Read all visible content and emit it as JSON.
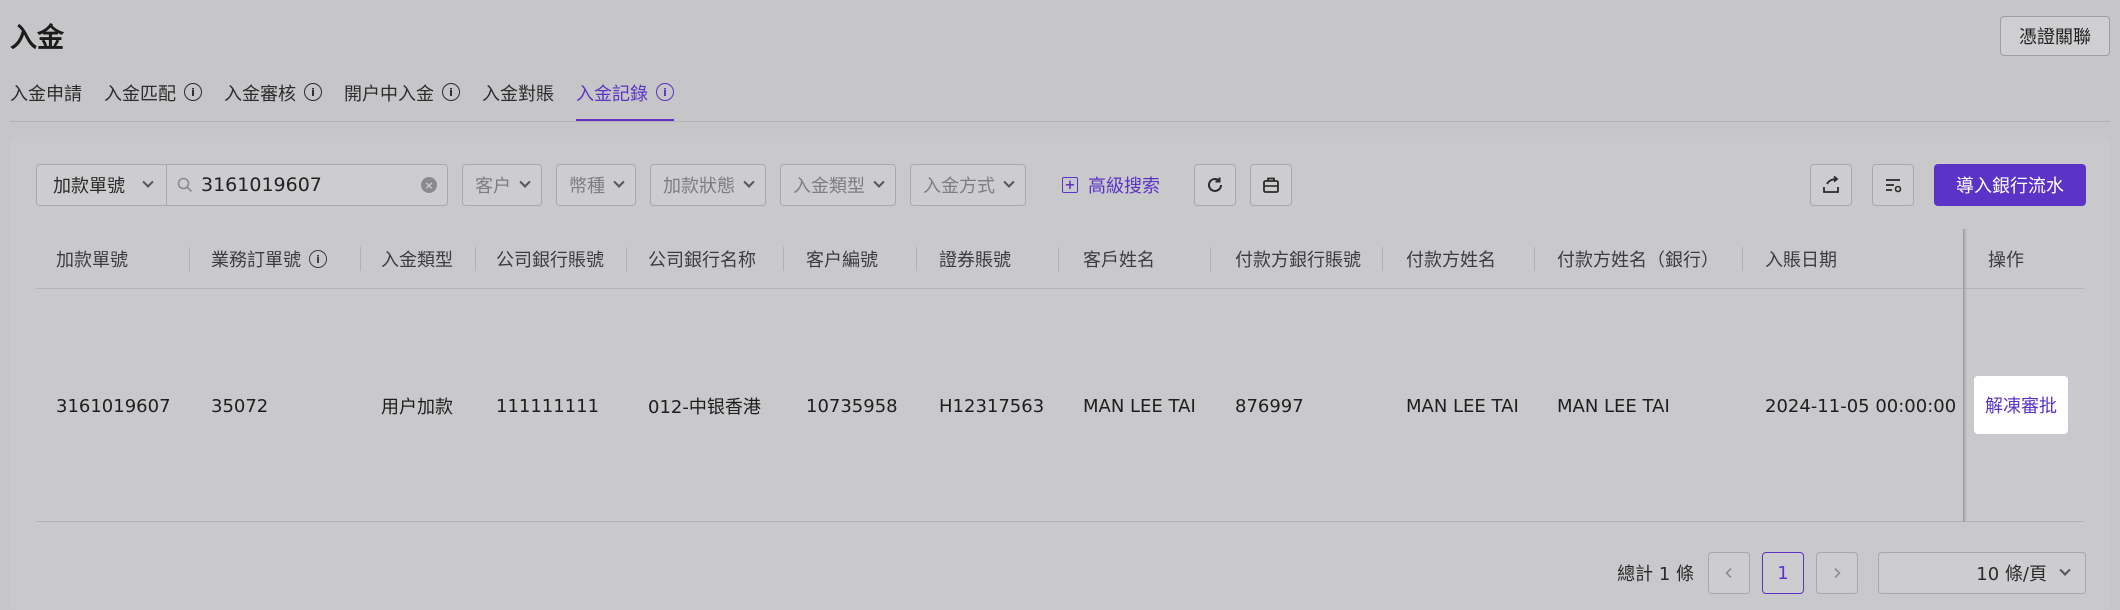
{
  "page": {
    "title": "入金",
    "voucher_button": "憑證關聯"
  },
  "tabs": [
    {
      "label": "入金申請",
      "info": false
    },
    {
      "label": "入金匹配",
      "info": true
    },
    {
      "label": "入金審核",
      "info": true
    },
    {
      "label": "開户中入金",
      "info": true
    },
    {
      "label": "入金對賬",
      "info": false
    },
    {
      "label": "入金記錄",
      "info": true,
      "active": true
    }
  ],
  "filters": {
    "field_select": "加款單號",
    "search_value": "3161019607",
    "customer": "客户",
    "currency": "幣種",
    "status": "加款狀態",
    "deposit_type": "入金類型",
    "deposit_method": "入金方式",
    "advanced_search": "高級搜索"
  },
  "toolbar": {
    "import_button": "導入銀行流水"
  },
  "table": {
    "headers": [
      "加款單號",
      "業務訂單號",
      "入金類型",
      "公司銀行賬號",
      "公司銀行名称",
      "客户編號",
      "證券賬號",
      "客戶姓名",
      "付款方銀行賬號",
      "付款方姓名",
      "付款方姓名（銀行）",
      "入賬日期",
      "操作"
    ],
    "rows": [
      {
        "cells": [
          "3161019607",
          "35072",
          "用户加款",
          "111111111",
          "012-中银香港",
          "10735958",
          "H12317563",
          "MAN LEE TAI",
          "876997",
          "MAN LEE TAI",
          "MAN LEE TAI",
          "2024-11-05 00:00:00"
        ],
        "action": "解凍審批"
      }
    ]
  },
  "pagination": {
    "total": "總計 1 條",
    "current_page": "1",
    "page_size": "10 條/頁"
  },
  "colors": {
    "accent": "#5b34c7",
    "overlay_bg": "#c6c5c8"
  },
  "icons": [
    "search-icon",
    "clear-icon",
    "chevron-down-icon",
    "info-icon",
    "plus-square-icon",
    "refresh-icon",
    "briefcase-icon",
    "export-icon",
    "column-settings-icon",
    "chevron-left-icon",
    "chevron-right-icon"
  ]
}
